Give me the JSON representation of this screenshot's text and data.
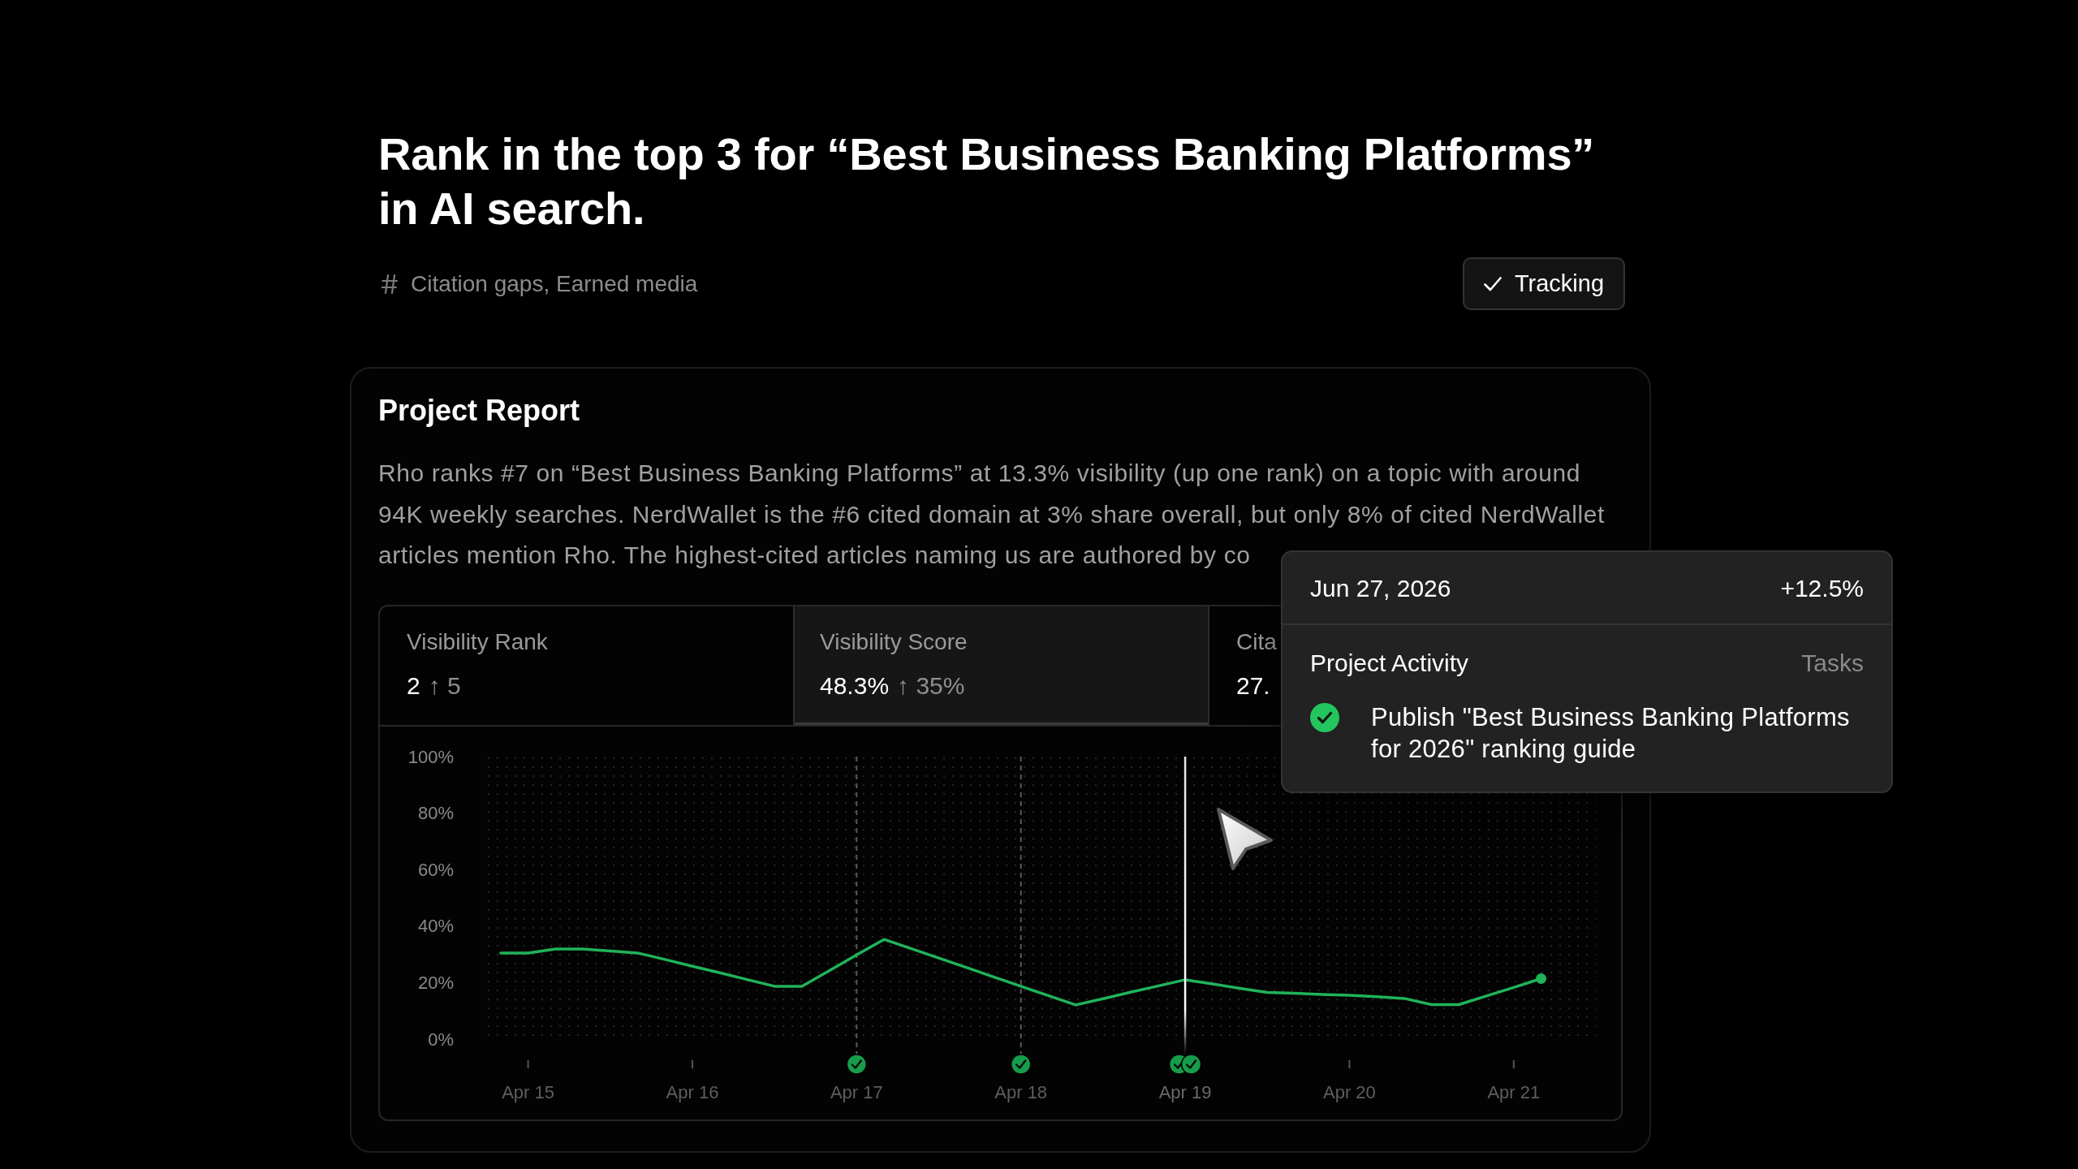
{
  "goal": {
    "title": "Rank in the top 3 for “Best Business Banking Platforms” in AI search.",
    "tags": "Citation gaps, Earned media",
    "tracking_button": {
      "label": "Tracking",
      "checked": true
    }
  },
  "report": {
    "title": "Project Report",
    "summary": "Rho ranks #7 on “Best Business Banking Platforms” at 13.3% visibility (up one rank) on a topic with around 94K weekly searches. NerdWallet is the #6 cited domain at 3% share overall, but only 8% of cited NerdWallet articles mention Rho. The highest-cited articles naming us are authored by co",
    "metric_tabs": [
      {
        "label": "Visibility Rank",
        "value": "2",
        "change": "↑ 5",
        "selected": false
      },
      {
        "label": "Visibility Score",
        "value": "48.3%",
        "change": "↑ 35%",
        "selected": true
      },
      {
        "label": "Cita",
        "value": "27.",
        "selected": false
      }
    ],
    "chart_data": {
      "type": "line",
      "categories": [
        null,
        "Apr 15",
        null,
        null,
        null,
        null,
        null,
        "Apr 16",
        null,
        null,
        null,
        null,
        null,
        "Apr 17",
        null,
        null,
        null,
        null,
        null,
        "Apr 18",
        null,
        null,
        null,
        null,
        null,
        "Apr 19",
        null,
        null,
        null,
        null,
        null,
        "Apr 20",
        null,
        null,
        null,
        null,
        null,
        "Apr 21",
        null
      ],
      "series": [
        {
          "color": "#20b35a",
          "values": [
            30.5,
            30.5,
            31.9,
            31.9,
            31.2,
            30.5,
            28.2,
            25.8,
            23.5,
            21.1,
            18.7,
            18.7,
            24.2,
            29.8,
            35.3,
            32.0,
            28.7,
            25.4,
            22.0,
            18.7,
            15.4,
            12.1,
            14.3,
            16.6,
            18.8,
            21.0,
            19.5,
            18.0,
            16.5,
            16.2,
            15.8,
            15.5,
            15.0,
            14.4,
            12.2,
            12.2,
            15.3,
            18.3,
            21.4
          ]
        }
      ],
      "ylim": [
        0,
        100
      ],
      "yticks": [
        {
          "value": 0,
          "label": "0%"
        },
        {
          "value": 20,
          "label": "20%"
        },
        {
          "value": 40,
          "label": "40%"
        },
        {
          "value": 60,
          "label": "60%"
        },
        {
          "value": 80,
          "label": "80%"
        },
        {
          "value": 100,
          "label": "100%"
        }
      ]
    },
    "activity_markers": [
      {
        "selected": false
      },
      {
        "selected": false
      },
      {
        "tasks": [
          {
            "done": true
          }
        ],
        "selected": false
      },
      {
        "tasks": [
          {
            "done": true
          }
        ],
        "selected": false
      },
      {
        "tasks": [
          {
            "done": true
          },
          {
            "done": true
          }
        ],
        "selected": true
      },
      {
        "selected": false
      },
      {
        "selected": false
      }
    ]
  },
  "tooltip": {
    "date": "Jun 27, 2026",
    "change": "+12.5%",
    "section": "Project Activity",
    "section_link": "Tasks",
    "tasks": [
      {
        "text": "Publish \"Best Business Banking Platforms for 2026\" ranking guide",
        "done": true
      }
    ]
  }
}
